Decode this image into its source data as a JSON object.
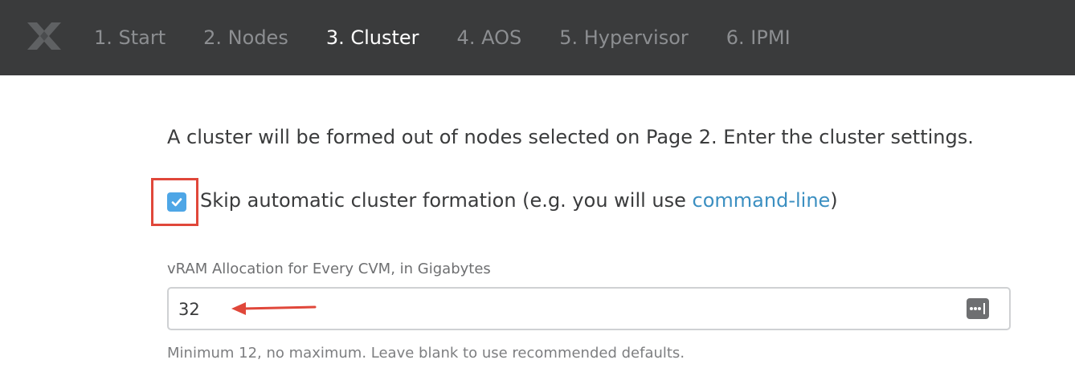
{
  "nav": {
    "logo_icon": "nutanix-x-logo-icon",
    "steps": [
      {
        "label": "1. Start",
        "active": false
      },
      {
        "label": "2. Nodes",
        "active": false
      },
      {
        "label": "3. Cluster",
        "active": true
      },
      {
        "label": "4. AOS",
        "active": false
      },
      {
        "label": "5. Hypervisor",
        "active": false
      },
      {
        "label": "6. IPMI",
        "active": false
      }
    ]
  },
  "main": {
    "intro": "A cluster will be formed out of nodes selected on Page 2. Enter the cluster settings.",
    "skip": {
      "checked": true,
      "label_prefix": "Skip automatic cluster formation (e.g. you will use ",
      "link": "command-line",
      "label_suffix": ")"
    },
    "vram": {
      "label": "vRAM Allocation for Every CVM, in Gigabytes",
      "value": "32",
      "hint": "Minimum 12, no maximum. Leave blank to use recommended defaults.",
      "icon": "password-dots-icon"
    }
  },
  "colors": {
    "topbar": "#3a3b3c",
    "accent": "#4ea6e6",
    "link": "#3b8fc1",
    "annotation": "#e0473a"
  }
}
